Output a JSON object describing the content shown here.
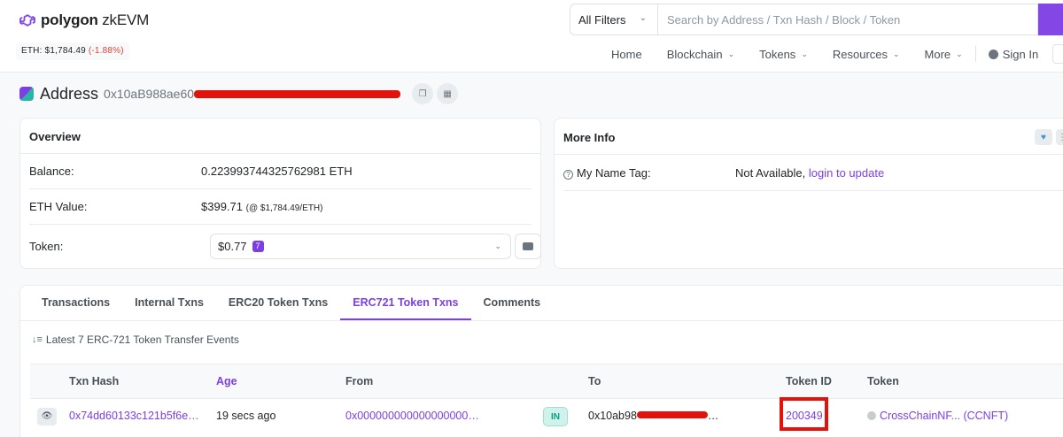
{
  "header": {
    "logo_text": "polygon",
    "logo_suffix": "zkEVM",
    "eth_price_label": "ETH: $1,784.49",
    "eth_price_change": "(-1.88%)",
    "filter_label": "All Filters",
    "search_placeholder": "Search by Address / Txn Hash / Block / Token",
    "nav": [
      "Home",
      "Blockchain",
      "Tokens",
      "Resources",
      "More"
    ],
    "sign_in": "Sign In"
  },
  "address": {
    "title": "Address",
    "hash_visible": "0x10aB988ae60"
  },
  "overview": {
    "title": "Overview",
    "balance_label": "Balance:",
    "balance_value": "0.223993744325762981 ETH",
    "eth_value_label": "ETH Value:",
    "eth_value": "$399.71",
    "eth_value_rate": "(@ $1,784.49/ETH)",
    "token_label": "Token:",
    "token_value": "$0.77",
    "token_count": "7"
  },
  "more_info": {
    "title": "More Info",
    "name_tag_label": "My Name Tag:",
    "name_tag_value": "Not Available,",
    "name_tag_link": "login to update"
  },
  "tabs": [
    "Transactions",
    "Internal Txns",
    "ERC20 Token Txns",
    "ERC721 Token Txns",
    "Comments"
  ],
  "active_tab": "ERC721 Token Txns",
  "events_summary": "Latest 7 ERC-721 Token Transfer Events",
  "table": {
    "headers": [
      "Txn Hash",
      "Age",
      "From",
      "To",
      "Token ID",
      "Token"
    ],
    "rows": [
      {
        "txn_hash": "0x74dd60133c121b5f6e…",
        "age": "19 secs ago",
        "from": "0x000000000000000000…",
        "direction": "IN",
        "to_prefix": "0x10ab98",
        "to_suffix": "…",
        "token_id": "200349",
        "token": "CrossChainNF... (CCNFT)"
      }
    ]
  },
  "colors": {
    "brand": "#7b3fe4",
    "negative": "#de4437",
    "in_badge": "#00a186",
    "redaction": "#e3120b"
  }
}
